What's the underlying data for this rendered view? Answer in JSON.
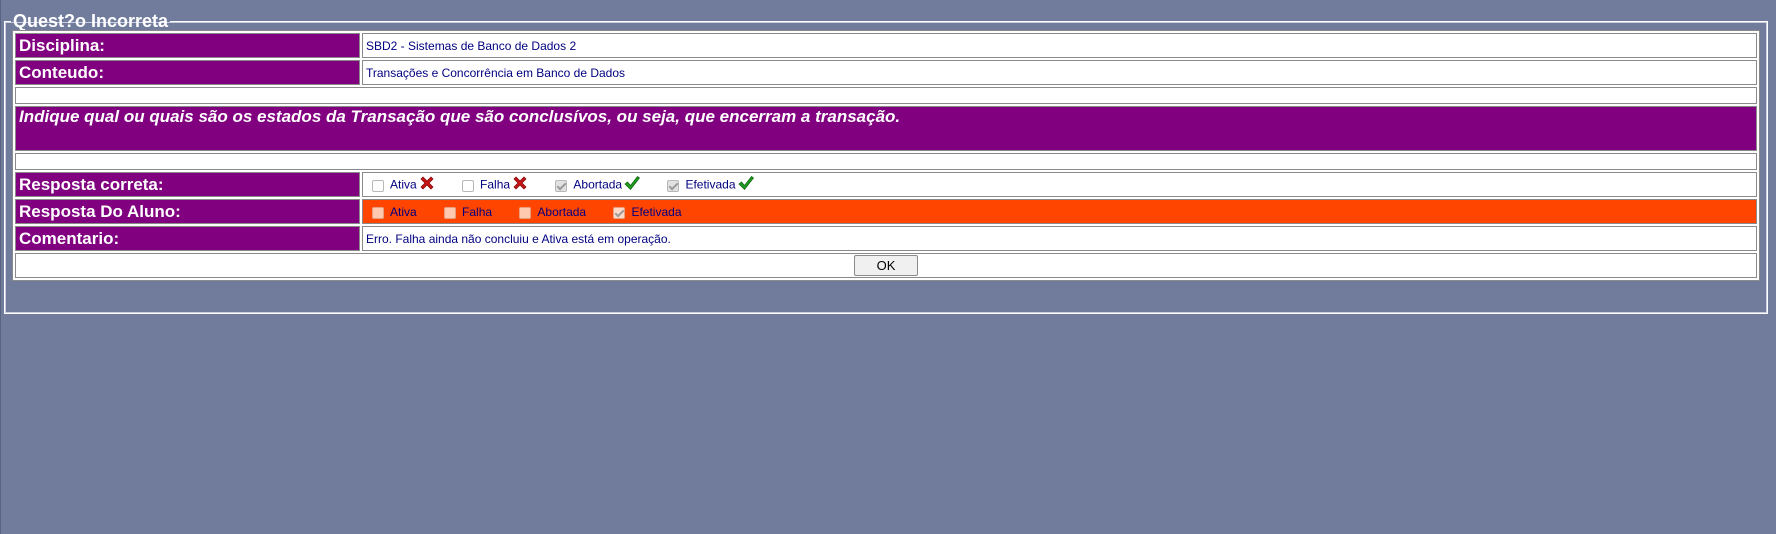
{
  "panel": {
    "legend": "Quest?o Incorreta"
  },
  "rows": {
    "disciplina": {
      "label": "Disciplina:",
      "value": "SBD2 - Sistemas de Banco de Dados 2"
    },
    "conteudo": {
      "label": "Conteudo:",
      "value": "Transações e Concorrência em Banco de Dados"
    },
    "question": "Indique qual ou quais são os estados da Transação que são conclusívos, ou seja, que encerram a transação.",
    "resposta_correta": {
      "label": "Resposta correta:",
      "options": [
        {
          "text": "Ativa",
          "checked": false,
          "mark": "cross-icon"
        },
        {
          "text": "Falha",
          "checked": false,
          "mark": "cross-icon"
        },
        {
          "text": "Abortada",
          "checked": true,
          "mark": "check-icon"
        },
        {
          "text": "Efetivada",
          "checked": true,
          "mark": "check-icon"
        }
      ]
    },
    "resposta_aluno": {
      "label": "Resposta Do Aluno:",
      "options": [
        {
          "text": "Ativa",
          "checked": false
        },
        {
          "text": "Falha",
          "checked": false
        },
        {
          "text": "Abortada",
          "checked": false
        },
        {
          "text": "Efetivada",
          "checked": true
        }
      ]
    },
    "comentario": {
      "label": "Comentario:",
      "value": "Erro. Falha ainda não concluiu e Ativa está em operação."
    }
  },
  "ok_button": "OK",
  "colors": {
    "background": "#717b9c",
    "label_bg": "#800080",
    "wrong_answer_bg": "#ff4500",
    "value_text": "#000080"
  }
}
